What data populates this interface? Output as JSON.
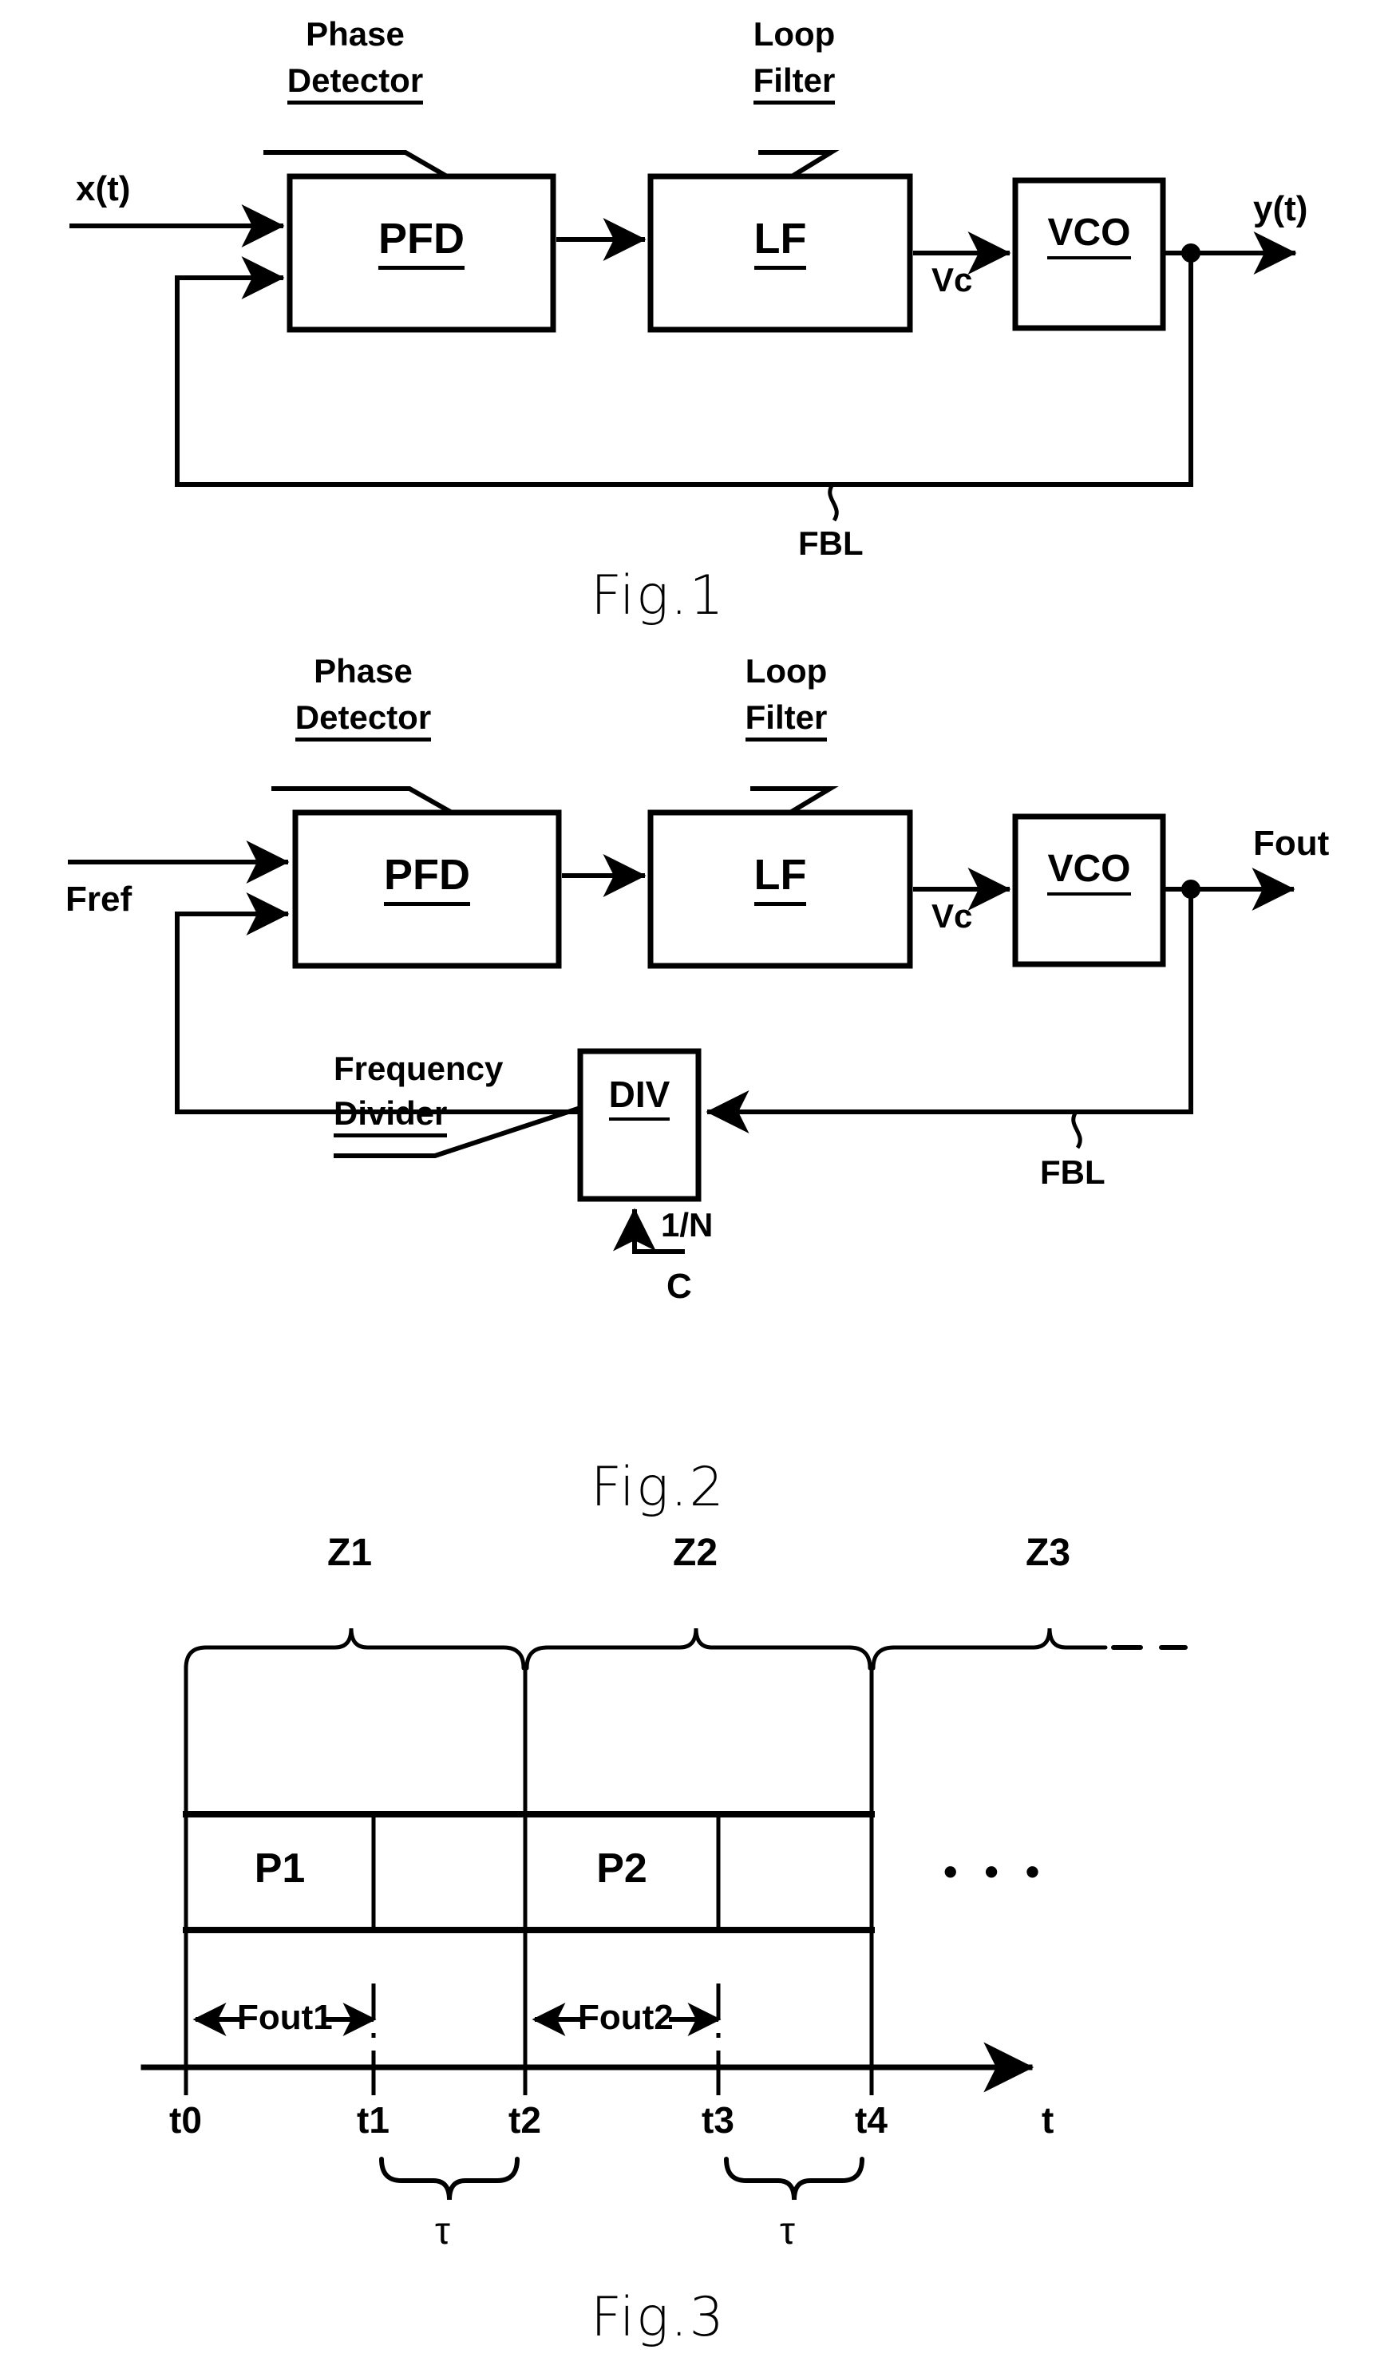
{
  "document": {
    "type": "patent-drawing-sheet",
    "figures": [
      "Fig.1",
      "Fig.2",
      "Fig.3"
    ]
  },
  "fig1": {
    "caption": "Fig.1",
    "callouts": {
      "phase_detector_line1": "Phase",
      "phase_detector_line2": "Detector",
      "loop_filter_line1": "Loop",
      "loop_filter_line2": "Filter",
      "feedback_loop": "FBL"
    },
    "blocks": [
      {
        "id": "pfd",
        "label": "PFD"
      },
      {
        "id": "lf",
        "label": "LF"
      },
      {
        "id": "vco",
        "label": "VCO"
      }
    ],
    "signals": {
      "input": "x(t)",
      "control_voltage": "Vc",
      "output": "y(t)"
    }
  },
  "fig2": {
    "caption": "Fig.2",
    "callouts": {
      "phase_detector_line1": "Phase",
      "phase_detector_line2": "Detector",
      "loop_filter_line1": "Loop",
      "loop_filter_line2": "Filter",
      "frequency_divider_line1": "Frequency",
      "frequency_divider_line2": "Divider",
      "feedback_loop": "FBL"
    },
    "blocks": [
      {
        "id": "pfd",
        "label": "PFD"
      },
      {
        "id": "lf",
        "label": "LF"
      },
      {
        "id": "vco",
        "label": "VCO"
      },
      {
        "id": "div",
        "label": "DIV"
      }
    ],
    "signals": {
      "input": "Fref",
      "control_voltage": "Vc",
      "output": "Fout",
      "divider_ratio": "1/N",
      "control_input": "C"
    }
  },
  "fig3": {
    "caption": "Fig.3",
    "zones": [
      "Z1",
      "Z2",
      "Z3"
    ],
    "zone_continuation": "dashed",
    "periods": [
      "P1",
      "P2"
    ],
    "period_continuation": "• • •",
    "measurements": [
      "Fout1",
      "Fout2"
    ],
    "time_ticks": [
      "t0",
      "t1",
      "t2",
      "t3",
      "t4"
    ],
    "axis_label": "t",
    "gap_labels": [
      "τ",
      "τ"
    ]
  },
  "style": {
    "ink": "#000000",
    "paper": "#ffffff"
  }
}
